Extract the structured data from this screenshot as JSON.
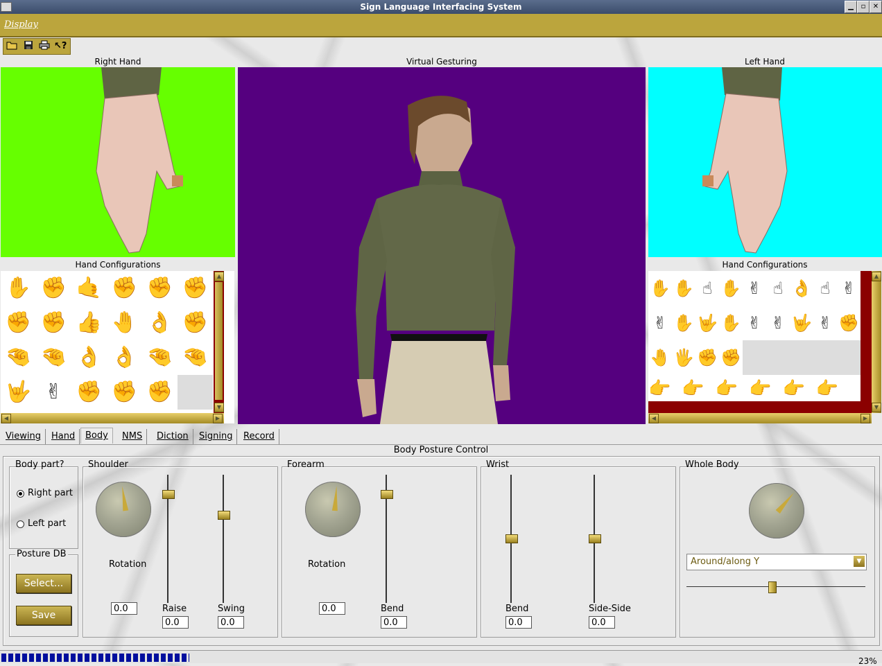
{
  "window": {
    "title": "Sign Language Interfacing System"
  },
  "menu": {
    "display": "Display"
  },
  "toolbar": {
    "icons": [
      "open-folder-icon",
      "save-disk-icon",
      "print-icon",
      "help-pointer-icon"
    ]
  },
  "panels": {
    "right_hand": {
      "title": "Right Hand",
      "bg": "#66ff00"
    },
    "virtual_gesturing": {
      "title": "Virtual Gesturing",
      "bg": "#55007f"
    },
    "left_hand": {
      "title": "Left Hand",
      "bg": "#00ffff"
    },
    "right_configs": {
      "title": "Hand Configurations"
    },
    "left_configs": {
      "title": "Hand Configurations"
    }
  },
  "tabs": [
    "Viewing",
    "Hand",
    "Body",
    "NMS",
    "Diction",
    "Signing",
    "Record"
  ],
  "active_tab": "Body",
  "body_control": {
    "title": "Body Posture Control",
    "body_part": {
      "label": "Body part?",
      "right": "Right part",
      "left": "Left part",
      "selected": "Right part"
    },
    "posture_db": {
      "label": "Posture DB",
      "select": "Select...",
      "save": "Save"
    },
    "shoulder": {
      "label": "Shoulder",
      "rotation_label": "Rotation",
      "rotation": "0.0",
      "raise_label": "Raise",
      "raise": "0.0",
      "swing_label": "Swing",
      "swing": "0.0"
    },
    "forearm": {
      "label": "Forearm",
      "rotation_label": "Rotation",
      "rotation": "0.0",
      "bend_label": "Bend",
      "bend": "0.0"
    },
    "wrist": {
      "label": "Wrist",
      "bend_label": "Bend",
      "bend": "0.0",
      "side_label": "Side-Side",
      "side": "0.0"
    },
    "whole_body": {
      "label": "Whole Body",
      "axis": "Around/along Y"
    }
  },
  "status": {
    "progress_pct": 23,
    "progress_text": "23%"
  },
  "colors": {
    "gold": "#bba53d",
    "dark_red": "#8b0000"
  }
}
